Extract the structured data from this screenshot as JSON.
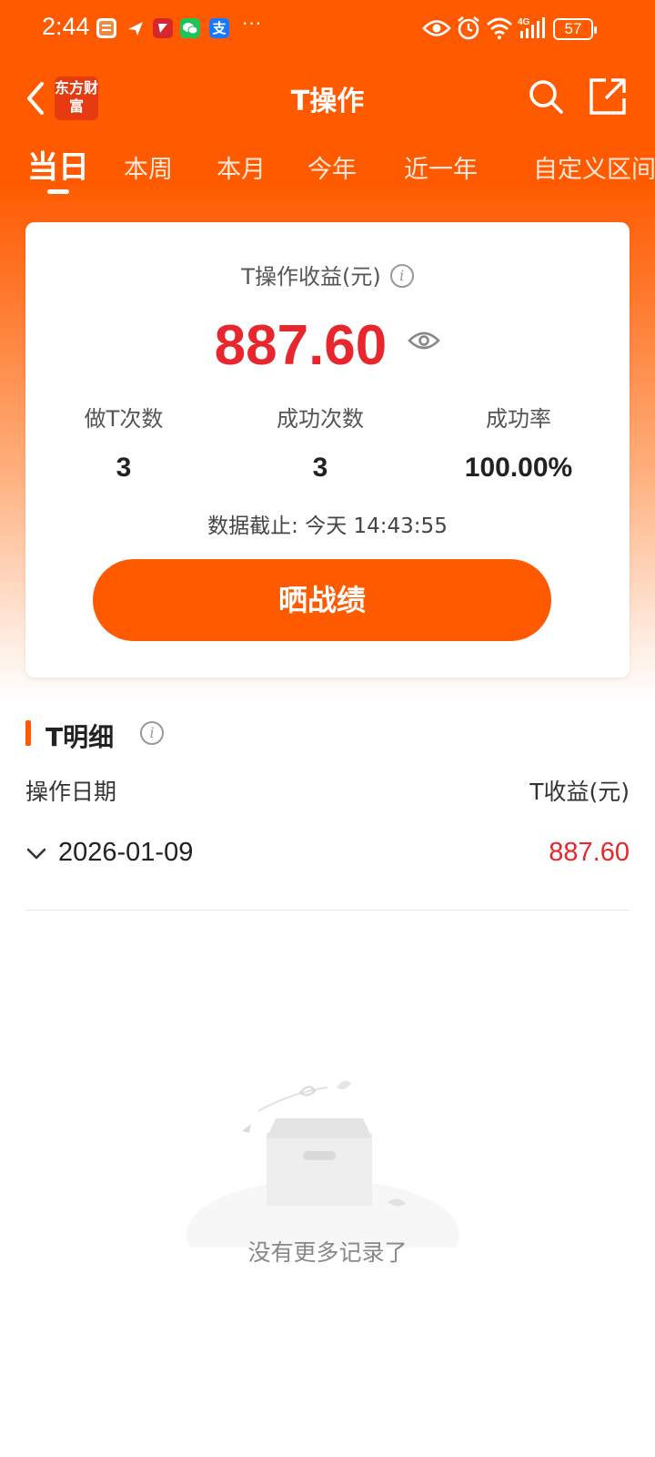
{
  "status_bar": {
    "time": "2:44",
    "more_indicator": "···",
    "battery": "57",
    "icons": [
      "eye-icon",
      "alarm-icon",
      "wifi-icon",
      "signal-4g-icon",
      "battery-icon"
    ]
  },
  "header": {
    "title": "T操作",
    "logo_text": "东方财富",
    "icons": [
      "back-arrow-icon",
      "search-icon",
      "share-icon"
    ]
  },
  "tabs": [
    {
      "label": "当日",
      "active": true
    },
    {
      "label": "本周",
      "active": false
    },
    {
      "label": "本月",
      "active": false
    },
    {
      "label": "今年",
      "active": false
    },
    {
      "label": "近一年",
      "active": false
    },
    {
      "label": "自定义区间",
      "active": false
    }
  ],
  "summary": {
    "profit_label": "T操作收益(元)",
    "profit_value": "887.60",
    "stats": [
      {
        "label": "做T次数",
        "value": "3"
      },
      {
        "label": "成功次数",
        "value": "3"
      },
      {
        "label": "成功率",
        "value": "100.00%"
      }
    ],
    "update_time": "数据截止: 今天 14:43:55",
    "share_button": "晒战绩"
  },
  "detail": {
    "title": "T明细",
    "col_date": "操作日期",
    "col_profit": "T收益(元)",
    "rows": [
      {
        "date": "2026-01-09",
        "profit": "887.60"
      }
    ]
  },
  "empty_state": {
    "text": "没有更多记录了"
  },
  "colors": {
    "brand_orange": "#ff5a00",
    "profit_red": "#e8262d"
  }
}
